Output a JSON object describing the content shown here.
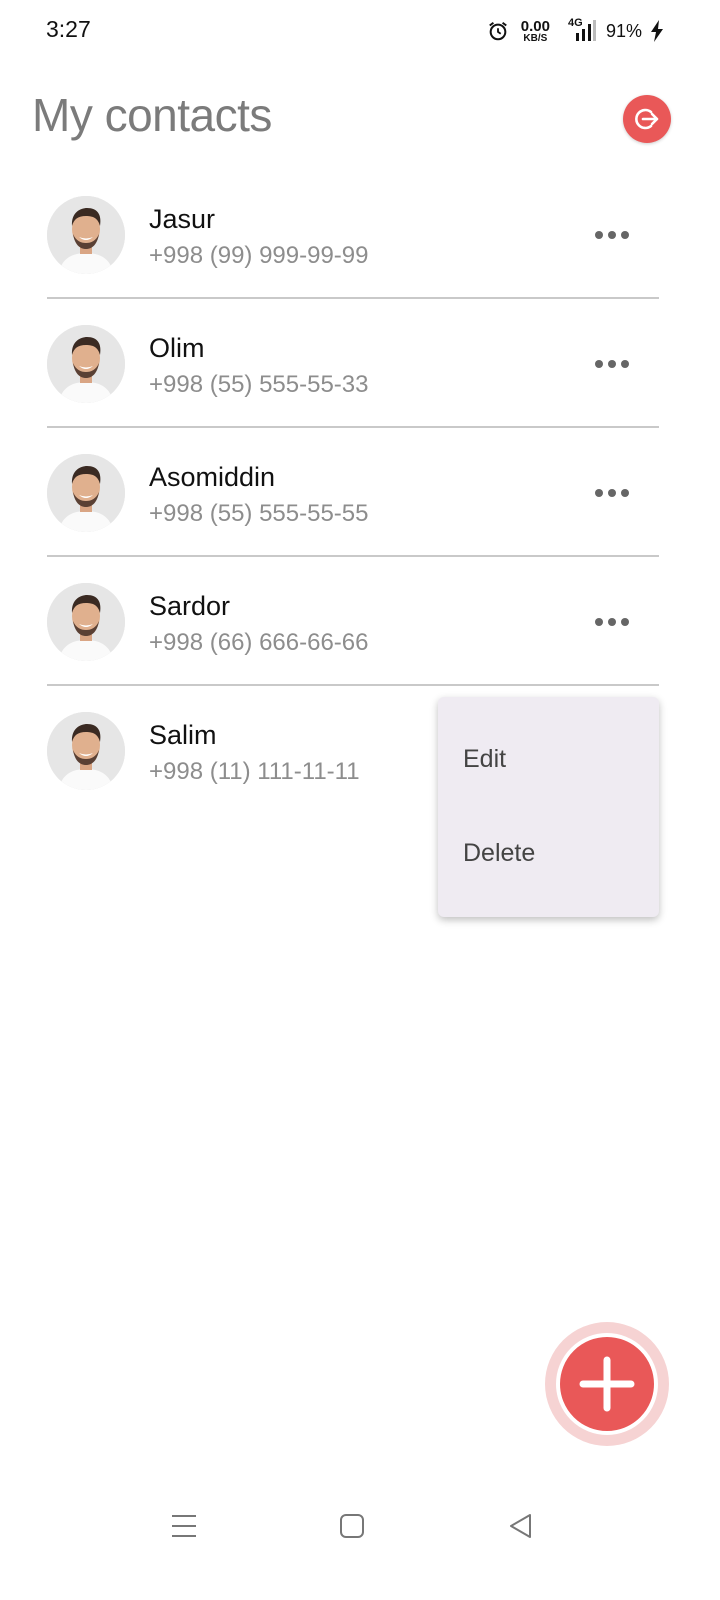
{
  "status_bar": {
    "time": "3:27",
    "net_speed_value": "0.00",
    "net_speed_unit": "KB/S",
    "network_type": "4G",
    "battery": "91%",
    "icons": [
      "alarm-icon",
      "signal-icon",
      "charging-bolt-icon"
    ]
  },
  "header": {
    "title": "My contacts",
    "logout_icon": "logout-icon",
    "accent_color": "#e95858"
  },
  "contacts": [
    {
      "name": "Jasur",
      "phone": "+998 (99) 999-99-99"
    },
    {
      "name": "Olim",
      "phone": "+998 (55) 555-55-33"
    },
    {
      "name": "Asomiddin",
      "phone": "+998 (55) 555-55-55"
    },
    {
      "name": "Sardor",
      "phone": "+998 (66) 666-66-66"
    },
    {
      "name": "Salim",
      "phone": "+998 (11) 111-11-11"
    }
  ],
  "popup_menu": {
    "edit_label": "Edit",
    "delete_label": "Delete"
  },
  "fab": {
    "icon": "plus-icon"
  },
  "nav_bar": {
    "icons": [
      "menu-icon",
      "home-icon",
      "back-icon"
    ]
  }
}
